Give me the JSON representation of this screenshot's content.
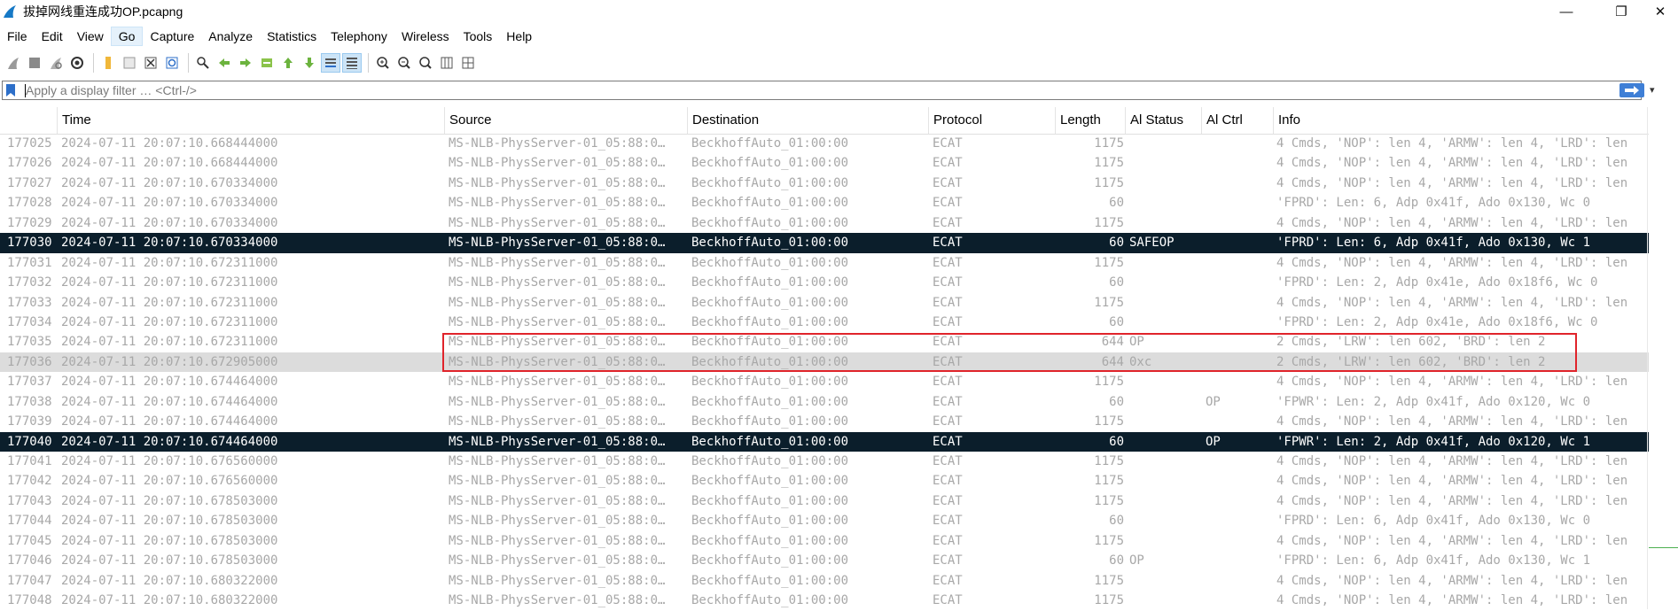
{
  "window": {
    "title": "拔掉网线重连成功OP.pcapng",
    "minimize": "—",
    "maximize": "❐",
    "close": "✕"
  },
  "menu": [
    "File",
    "Edit",
    "View",
    "Go",
    "Capture",
    "Analyze",
    "Statistics",
    "Telephony",
    "Wireless",
    "Tools",
    "Help"
  ],
  "menu_active": "Go",
  "toolbar_icons": [
    "shark-fin-start-icon",
    "stop-capture-icon",
    "restart-capture-icon",
    "capture-options-icon",
    "open-file-icon",
    "save-file-icon",
    "close-file-icon",
    "reload-file-icon",
    "find-packet-icon",
    "go-back-icon",
    "go-forward-icon",
    "go-to-packet-icon",
    "go-first-icon",
    "go-last-icon",
    "autoscroll-icon",
    "colorize-icon",
    "zoom-in-icon",
    "zoom-out-icon",
    "zoom-normal-icon",
    "resize-columns-icon",
    "expand-icon"
  ],
  "filter": {
    "placeholder": "Apply a display filter … <Ctrl-/>",
    "apply_label": "apply-arrow"
  },
  "columns": {
    "no": "",
    "time": "Time",
    "source": "Source",
    "destination": "Destination",
    "protocol": "Protocol",
    "length": "Length",
    "al_status": "Al Status",
    "al_ctrl": "Al Ctrl",
    "info": "Info"
  },
  "packets": [
    {
      "no": "177025",
      "time": "2024-07-11 20:07:10.668444000",
      "src": "MS-NLB-PhysServer-01_05:88:0…",
      "dst": "BeckhoffAuto_01:00:00",
      "proto": "ECAT",
      "len": "1175",
      "alst": "",
      "alct": "",
      "info": "4 Cmds, 'NOP': len 4, 'ARMW': len 4, 'LRD': len",
      "state": "normal"
    },
    {
      "no": "177026",
      "time": "2024-07-11 20:07:10.668444000",
      "src": "MS-NLB-PhysServer-01_05:88:0…",
      "dst": "BeckhoffAuto_01:00:00",
      "proto": "ECAT",
      "len": "1175",
      "alst": "",
      "alct": "",
      "info": "4 Cmds, 'NOP': len 4, 'ARMW': len 4, 'LRD': len",
      "state": "normal"
    },
    {
      "no": "177027",
      "time": "2024-07-11 20:07:10.670334000",
      "src": "MS-NLB-PhysServer-01_05:88:0…",
      "dst": "BeckhoffAuto_01:00:00",
      "proto": "ECAT",
      "len": "1175",
      "alst": "",
      "alct": "",
      "info": "4 Cmds, 'NOP': len 4, 'ARMW': len 4, 'LRD': len",
      "state": "normal"
    },
    {
      "no": "177028",
      "time": "2024-07-11 20:07:10.670334000",
      "src": "MS-NLB-PhysServer-01_05:88:0…",
      "dst": "BeckhoffAuto_01:00:00",
      "proto": "ECAT",
      "len": "60",
      "alst": "",
      "alct": "",
      "info": "'FPRD': Len: 6, Adp 0x41f, Ado 0x130, Wc 0",
      "state": "normal"
    },
    {
      "no": "177029",
      "time": "2024-07-11 20:07:10.670334000",
      "src": "MS-NLB-PhysServer-01_05:88:0…",
      "dst": "BeckhoffAuto_01:00:00",
      "proto": "ECAT",
      "len": "1175",
      "alst": "",
      "alct": "",
      "info": "4 Cmds, 'NOP': len 4, 'ARMW': len 4, 'LRD': len",
      "state": "normal"
    },
    {
      "no": "177030",
      "time": "2024-07-11 20:07:10.670334000",
      "src": "MS-NLB-PhysServer-01_05:88:0…",
      "dst": "BeckhoffAuto_01:00:00",
      "proto": "ECAT",
      "len": "60",
      "alst": "SAFEOP",
      "alct": "",
      "info": "'FPRD': Len: 6, Adp 0x41f, Ado 0x130, Wc 1",
      "state": "selected"
    },
    {
      "no": "177031",
      "time": "2024-07-11 20:07:10.672311000",
      "src": "MS-NLB-PhysServer-01_05:88:0…",
      "dst": "BeckhoffAuto_01:00:00",
      "proto": "ECAT",
      "len": "1175",
      "alst": "",
      "alct": "",
      "info": "4 Cmds, 'NOP': len 4, 'ARMW': len 4, 'LRD': len",
      "state": "normal"
    },
    {
      "no": "177032",
      "time": "2024-07-11 20:07:10.672311000",
      "src": "MS-NLB-PhysServer-01_05:88:0…",
      "dst": "BeckhoffAuto_01:00:00",
      "proto": "ECAT",
      "len": "60",
      "alst": "",
      "alct": "",
      "info": "'FPRD': Len: 2, Adp 0x41e, Ado 0x18f6, Wc 0",
      "state": "normal"
    },
    {
      "no": "177033",
      "time": "2024-07-11 20:07:10.672311000",
      "src": "MS-NLB-PhysServer-01_05:88:0…",
      "dst": "BeckhoffAuto_01:00:00",
      "proto": "ECAT",
      "len": "1175",
      "alst": "",
      "alct": "",
      "info": "4 Cmds, 'NOP': len 4, 'ARMW': len 4, 'LRD': len",
      "state": "normal"
    },
    {
      "no": "177034",
      "time": "2024-07-11 20:07:10.672311000",
      "src": "MS-NLB-PhysServer-01_05:88:0…",
      "dst": "BeckhoffAuto_01:00:00",
      "proto": "ECAT",
      "len": "60",
      "alst": "",
      "alct": "",
      "info": "'FPRD': Len: 2, Adp 0x41e, Ado 0x18f6, Wc 0",
      "state": "normal"
    },
    {
      "no": "177035",
      "time": "2024-07-11 20:07:10.672311000",
      "src": "MS-NLB-PhysServer-01_05:88:0…",
      "dst": "BeckhoffAuto_01:00:00",
      "proto": "ECAT",
      "len": "644",
      "alst": "OP",
      "alct": "",
      "info": "2 Cmds, 'LRW': len 602, 'BRD': len 2",
      "state": "normal"
    },
    {
      "no": "177036",
      "time": "2024-07-11 20:07:10.672905000",
      "src": "MS-NLB-PhysServer-01_05:88:0…",
      "dst": "BeckhoffAuto_01:00:00",
      "proto": "ECAT",
      "len": "644",
      "alst": "0xc",
      "alct": "",
      "info": "2 Cmds, 'LRW': len 602, 'BRD': len 2",
      "state": "highlighted"
    },
    {
      "no": "177037",
      "time": "2024-07-11 20:07:10.674464000",
      "src": "MS-NLB-PhysServer-01_05:88:0…",
      "dst": "BeckhoffAuto_01:00:00",
      "proto": "ECAT",
      "len": "1175",
      "alst": "",
      "alct": "",
      "info": "4 Cmds, 'NOP': len 4, 'ARMW': len 4, 'LRD': len",
      "state": "normal"
    },
    {
      "no": "177038",
      "time": "2024-07-11 20:07:10.674464000",
      "src": "MS-NLB-PhysServer-01_05:88:0…",
      "dst": "BeckhoffAuto_01:00:00",
      "proto": "ECAT",
      "len": "60",
      "alst": "",
      "alct": "OP",
      "info": "'FPWR': Len: 2, Adp 0x41f, Ado 0x120, Wc 0",
      "state": "normal"
    },
    {
      "no": "177039",
      "time": "2024-07-11 20:07:10.674464000",
      "src": "MS-NLB-PhysServer-01_05:88:0…",
      "dst": "BeckhoffAuto_01:00:00",
      "proto": "ECAT",
      "len": "1175",
      "alst": "",
      "alct": "",
      "info": "4 Cmds, 'NOP': len 4, 'ARMW': len 4, 'LRD': len",
      "state": "normal"
    },
    {
      "no": "177040",
      "time": "2024-07-11 20:07:10.674464000",
      "src": "MS-NLB-PhysServer-01_05:88:0…",
      "dst": "BeckhoffAuto_01:00:00",
      "proto": "ECAT",
      "len": "60",
      "alst": "",
      "alct": "OP",
      "info": "'FPWR': Len: 2, Adp 0x41f, Ado 0x120, Wc 1",
      "state": "selected"
    },
    {
      "no": "177041",
      "time": "2024-07-11 20:07:10.676560000",
      "src": "MS-NLB-PhysServer-01_05:88:0…",
      "dst": "BeckhoffAuto_01:00:00",
      "proto": "ECAT",
      "len": "1175",
      "alst": "",
      "alct": "",
      "info": "4 Cmds, 'NOP': len 4, 'ARMW': len 4, 'LRD': len",
      "state": "normal"
    },
    {
      "no": "177042",
      "time": "2024-07-11 20:07:10.676560000",
      "src": "MS-NLB-PhysServer-01_05:88:0…",
      "dst": "BeckhoffAuto_01:00:00",
      "proto": "ECAT",
      "len": "1175",
      "alst": "",
      "alct": "",
      "info": "4 Cmds, 'NOP': len 4, 'ARMW': len 4, 'LRD': len",
      "state": "normal"
    },
    {
      "no": "177043",
      "time": "2024-07-11 20:07:10.678503000",
      "src": "MS-NLB-PhysServer-01_05:88:0…",
      "dst": "BeckhoffAuto_01:00:00",
      "proto": "ECAT",
      "len": "1175",
      "alst": "",
      "alct": "",
      "info": "4 Cmds, 'NOP': len 4, 'ARMW': len 4, 'LRD': len",
      "state": "normal"
    },
    {
      "no": "177044",
      "time": "2024-07-11 20:07:10.678503000",
      "src": "MS-NLB-PhysServer-01_05:88:0…",
      "dst": "BeckhoffAuto_01:00:00",
      "proto": "ECAT",
      "len": "60",
      "alst": "",
      "alct": "",
      "info": "'FPRD': Len: 6, Adp 0x41f, Ado 0x130, Wc 0",
      "state": "normal"
    },
    {
      "no": "177045",
      "time": "2024-07-11 20:07:10.678503000",
      "src": "MS-NLB-PhysServer-01_05:88:0…",
      "dst": "BeckhoffAuto_01:00:00",
      "proto": "ECAT",
      "len": "1175",
      "alst": "",
      "alct": "",
      "info": "4 Cmds, 'NOP': len 4, 'ARMW': len 4, 'LRD': len",
      "state": "normal"
    },
    {
      "no": "177046",
      "time": "2024-07-11 20:07:10.678503000",
      "src": "MS-NLB-PhysServer-01_05:88:0…",
      "dst": "BeckhoffAuto_01:00:00",
      "proto": "ECAT",
      "len": "60",
      "alst": "OP",
      "alct": "",
      "info": "'FPRD': Len: 6, Adp 0x41f, Ado 0x130, Wc 1",
      "state": "normal"
    },
    {
      "no": "177047",
      "time": "2024-07-11 20:07:10.680322000",
      "src": "MS-NLB-PhysServer-01_05:88:0…",
      "dst": "BeckhoffAuto_01:00:00",
      "proto": "ECAT",
      "len": "1175",
      "alst": "",
      "alct": "",
      "info": "4 Cmds, 'NOP': len 4, 'ARMW': len 4, 'LRD': len",
      "state": "normal"
    },
    {
      "no": "177048",
      "time": "2024-07-11 20:07:10.680322000",
      "src": "MS-NLB-PhysServer-01_05:88:0…",
      "dst": "BeckhoffAuto_01:00:00",
      "proto": "ECAT",
      "len": "1175",
      "alst": "",
      "alct": "",
      "info": "4 Cmds, 'NOP': len 4, 'ARMW': len 4, 'LRD': len",
      "state": "normal"
    }
  ],
  "colors": {
    "selected_row_bg": "#0b1e2b",
    "selected_row_fg": "#ffffff",
    "normal_row_fg": "#a8a8a8",
    "highlight_row_bg": "#dcdcdc",
    "annotation_box": "#e0242b",
    "apply_button": "#3f7fd6"
  }
}
